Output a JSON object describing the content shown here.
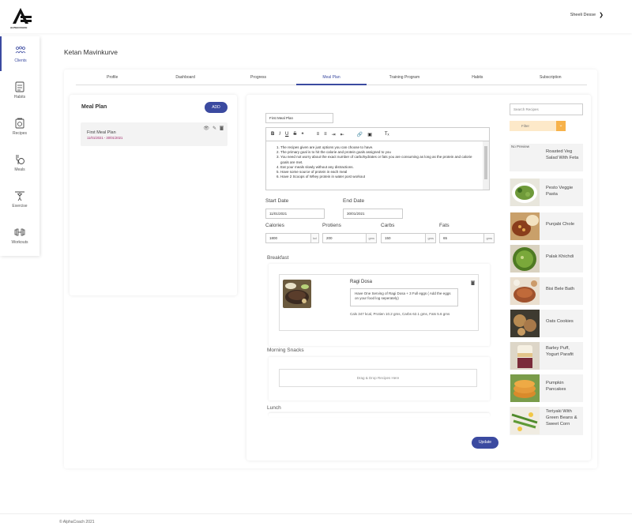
{
  "header": {
    "logo_text": "ALPHACOACH",
    "user_name": "Sheeli Desse"
  },
  "sidebar": {
    "items": [
      {
        "label": "Clients",
        "icon": "clients-icon"
      },
      {
        "label": "Habits",
        "icon": "habits-icon"
      },
      {
        "label": "Recipes",
        "icon": "recipes-icon"
      },
      {
        "label": "Meals",
        "icon": "meals-icon"
      },
      {
        "label": "Exercise",
        "icon": "exercise-icon"
      },
      {
        "label": "Workouts",
        "icon": "workouts-icon"
      }
    ]
  },
  "client_name": "Ketan Mavinkurve",
  "tabs": [
    "Profile",
    "Dashboard",
    "Progress",
    "Meal Plan",
    "Training Program",
    "Habits",
    "Subscription"
  ],
  "meal_plan_panel": {
    "title": "Meal Plan",
    "add_label": "ADD",
    "plan": {
      "name": "First Meal Plan",
      "dates": "11/01/2021 - 30/01/2021"
    }
  },
  "editor": {
    "plan_name": "First Meal Plan",
    "notes": [
      "The recipes given are just options you can choose to have.",
      "The primary goal is to hit the calorie and protein goals assigned to you",
      "You need not worry about the exact number of carbohydrates or fats you are consuming as long as the protein and calorie goals are met.",
      "Eat your meals slowly without any distractions.",
      "Have some source of protein in each meal",
      "Have 2 Scoops of Whey protein in water post workout"
    ],
    "start_date_label": "Start Date",
    "start_date": "11/01/2021",
    "end_date_label": "End Date",
    "end_date": "30/01/2021",
    "calories_label": "Calories",
    "calories": "1800",
    "calories_unit": "kcl",
    "proteins_label": "Protiens",
    "proteins": "200",
    "proteins_unit": "gms",
    "carbs_label": "Carbs",
    "carbs": "150",
    "carbs_unit": "gms",
    "fats_label": "Fats",
    "fats": "65",
    "fats_unit": "gms",
    "breakfast_label": "Breakfast",
    "breakfast_recipe": {
      "name": "Ragi Dosa",
      "note": "Have One Serving of Ragi Dosa + 3 Full eggs ( Add the eggs on your food log seperately)",
      "macros": "Cals 347 kcal, Protien 10.2 gms, Carbs 62.1 gms, Fats 5.6 gms"
    },
    "snacks_label": "Morning Snacks",
    "dropzone_text": "Drag & Drop Recipes Here",
    "lunch_label": "Lunch",
    "update_label": "Update"
  },
  "recipes": {
    "search_placeholder": "Search Recipes",
    "filter_label": "Filter",
    "no_preview": "No Preview",
    "items": [
      "Roasted Veg Salad With Feta",
      "Pesto Veggie Pasta",
      "Punjabi Chole",
      "Palak Khichdi",
      "Bisi Bele Bath",
      "Oats Cookies",
      "Barley Puff, Yogurt Parafit",
      "Pumpkin Pancakes",
      "Teriyaki With Green Beans & Sweet Corn"
    ]
  },
  "footer": "© AlphaCoach 2021"
}
